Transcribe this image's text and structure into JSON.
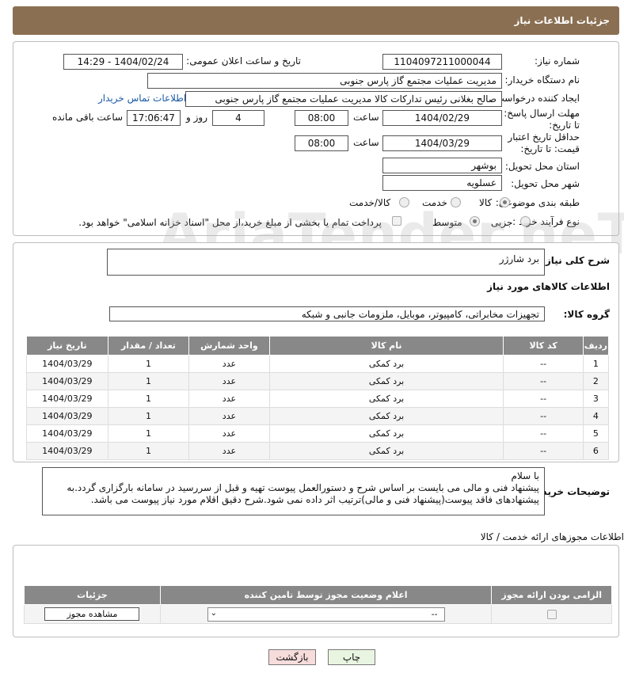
{
  "header": {
    "title": "جزئیات اطلاعات نیاز"
  },
  "form": {
    "need_number_label": "شماره نیاز:",
    "need_number": "1104097211000044",
    "announce_label": "تاریخ و ساعت اعلان عمومی:",
    "announce_value": "1404/02/24 - 14:29",
    "buyer_org_label": "نام دستگاه خریدار:",
    "buyer_org": "مدیریت عملیات مجتمع گاز پارس جنوبی",
    "creator_label": "ایجاد کننده درخواست:",
    "creator": "صالح بغلانی  رئیس تدارکات کالا  مدیریت عملیات مجتمع گاز پارس جنوبی",
    "contact_link": "اطلاعات تماس خریدار",
    "deadline_label": "مهلت ارسال پاسخ: تا تاریخ:",
    "deadline_date": "1404/02/29",
    "time_label": "ساعت",
    "deadline_time": "08:00",
    "days_value": "4",
    "days_label": "روز و",
    "remaining_time": "17:06:47",
    "remaining_label": "ساعت باقی مانده",
    "validity_label": "حداقل تاریخ اعتبار قیمت: تا تاریخ:",
    "validity_date": "1404/03/29",
    "validity_time": "08:00",
    "province_label": "استان محل تحویل:",
    "province": "بوشهر",
    "city_label": "شهر محل تحویل:",
    "city": "عسلویه",
    "category_label": "طبقه بندی موضوعی:",
    "category_options": [
      "کالا",
      "خدمت",
      "کالا/خدمت"
    ],
    "purchase_type_label": "نوع فرآیند خرید :",
    "purchase_options": [
      "جزیی",
      "متوسط"
    ],
    "payment_note": "پرداخت تمام یا بخشی از مبلغ خرید،از محل \"اسناد خزانه اسلامی\" خواهد بود."
  },
  "summary": {
    "label": "شرح کلی نیاز:",
    "value": "برد شارژر",
    "goods_info_title": "اطلاعات کالاهای مورد نیاز",
    "group_label": "گروه کالا:",
    "group_value": "تجهیزات مخابراتی، کامپیوتر، موبایل، ملزومات جانبی و شبکه"
  },
  "items_table": {
    "headers": [
      "ردیف",
      "کد کالا",
      "نام کالا",
      "واحد شمارش",
      "تعداد / مقدار",
      "تاریخ نیاز"
    ],
    "rows": [
      [
        "1",
        "--",
        "برد کمکی",
        "عدد",
        "1",
        "1404/03/29"
      ],
      [
        "2",
        "--",
        "برد کمکی",
        "عدد",
        "1",
        "1404/03/29"
      ],
      [
        "3",
        "--",
        "برد کمکی",
        "عدد",
        "1",
        "1404/03/29"
      ],
      [
        "4",
        "--",
        "برد کمکی",
        "عدد",
        "1",
        "1404/03/29"
      ],
      [
        "5",
        "--",
        "برد کمکی",
        "عدد",
        "1",
        "1404/03/29"
      ],
      [
        "6",
        "--",
        "برد کمکی",
        "عدد",
        "1",
        "1404/03/29"
      ]
    ]
  },
  "buyer_notes": {
    "label": "توضیحات خریدار:",
    "line1": "با سلام",
    "line2": "پیشنهاد فنی و مالی می بایست بر اساس شرح و دستورالعمل پیوست تهیه و قبل از سررسید در سامانه بارگزاری گردد.به",
    "line3": "پیشنهادهای فاقد پیوست(پیشنهاد فنی و مالی)ترتیب اثر داده نمی شود.شرح دقیق اقلام مورد نیاز پیوست می باشد."
  },
  "licenses": {
    "title": "اطلاعات مجوزهای ارائه خدمت / کالا",
    "headers": [
      "الزامی بودن ارائه مجوز",
      "اعلام وضعیت مجوز توسط تامین کننده",
      "جزئیات"
    ],
    "select_value": "--",
    "view_button": "مشاهده مجوز"
  },
  "footer": {
    "print_button": "چاپ",
    "back_button": "بازگشت"
  },
  "watermark": "AriaTender.neT",
  "colors": {
    "title_bar": "#8b6f52",
    "table_header": "#888888",
    "link": "#1a5aa6",
    "back_button": "#f7dcdc",
    "print_button": "#e9f5e1"
  }
}
